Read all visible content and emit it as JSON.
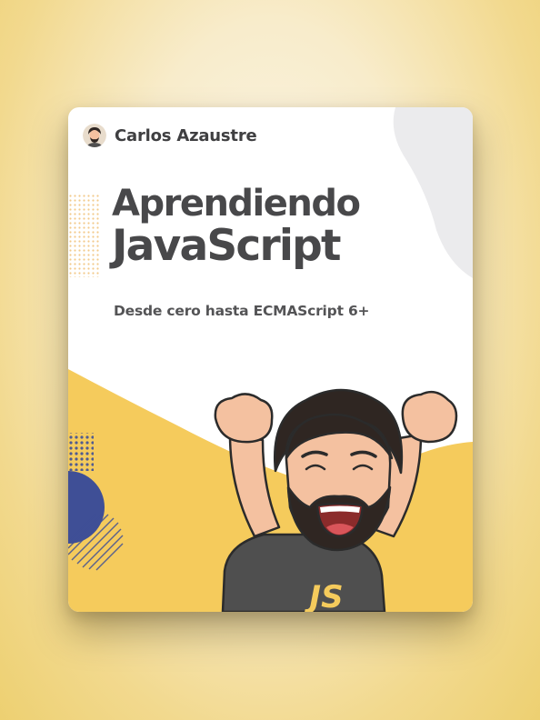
{
  "author": {
    "name": "Carlos Azaustre"
  },
  "book": {
    "title_line1": "Aprendiendo",
    "title_line2": "JavaScript",
    "subtitle": "Desde cero hasta ECMAScript 6+",
    "shirt_text": "JS"
  },
  "colors": {
    "background": "#f2d98e",
    "card": "#ffffff",
    "accent_yellow": "#f5cb5c",
    "accent_blue": "#3f4f96",
    "text": "#48484a",
    "gray_blob": "#ebebed"
  }
}
